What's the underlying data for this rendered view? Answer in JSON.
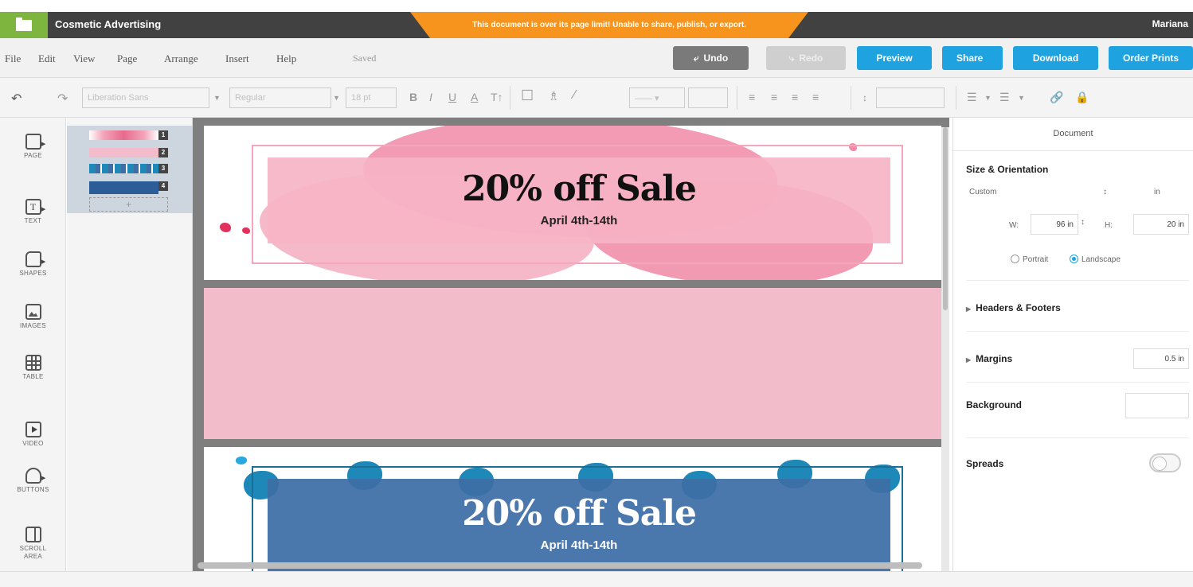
{
  "titlebar": {
    "doc_title": "Cosmetic Advertising",
    "warning": "This document is over its page limit! Unable to share, publish, or export.",
    "user": "Mariana"
  },
  "menu": {
    "items": [
      "File",
      "Edit",
      "View",
      "Page",
      "Arrange",
      "Insert",
      "Help"
    ],
    "status": "Saved"
  },
  "actions": {
    "undo": "Undo",
    "redo": "Redo",
    "preview": "Preview",
    "share": "Share",
    "download": "Download",
    "order_prints": "Order Prints"
  },
  "toolbar": {
    "font_family": "Liberation Sans",
    "font_weight": "Regular",
    "font_size": "18 pt"
  },
  "left_tools": [
    "PAGE",
    "TEXT",
    "SHAPES",
    "IMAGES",
    "TABLE",
    "VIDEO",
    "BUTTONS",
    "SCROLL AREA"
  ],
  "thumbnails": [
    "1",
    "2",
    "3",
    "4"
  ],
  "canvas": {
    "banner1_title": "20% off Sale",
    "banner1_date": "April 4th-14th",
    "banner2_title": "20% off Sale",
    "banner2_date": "April 4th-14th"
  },
  "panel": {
    "header": "Document",
    "size_heading": "Size & Orientation",
    "size_preset": "Custom",
    "unit": "in",
    "width_label": "W:",
    "width_value": "96 in",
    "height_label": "H:",
    "height_value": "20 in",
    "portrait": "Portrait",
    "landscape": "Landscape",
    "headers_footers": "Headers & Footers",
    "margins": "Margins",
    "margins_value": "0.5 in",
    "background": "Background",
    "spreads": "Spreads"
  },
  "colors": {
    "brand_green": "#7db53e",
    "accent_blue": "#1fa3e0",
    "warning_orange": "#f7941e",
    "banner_pink": "#f2bccb",
    "banner_blue": "#3d6ea6"
  }
}
